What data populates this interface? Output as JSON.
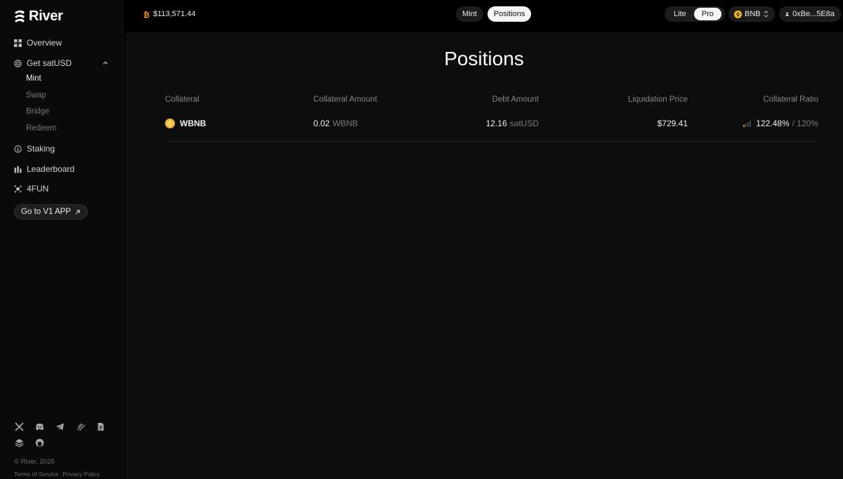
{
  "brand": {
    "name": "River"
  },
  "sidebar": {
    "items": [
      {
        "label": "Overview",
        "icon": "grid-icon"
      },
      {
        "label": "Get satUSD",
        "icon": "target-icon",
        "expanded": true,
        "subitems": [
          {
            "label": "Mint",
            "active": true
          },
          {
            "label": "Swap",
            "active": false
          },
          {
            "label": "Bridge",
            "active": false
          },
          {
            "label": "Redeem",
            "active": false
          }
        ]
      },
      {
        "label": "Staking",
        "icon": "coin-icon"
      },
      {
        "label": "Leaderboard",
        "icon": "bar-chart-icon"
      },
      {
        "label": "4FUN",
        "icon": "sparkle-icon"
      }
    ],
    "v1_button": "Go to V1 APP",
    "socials": [
      "x-icon",
      "discord-icon",
      "telegram-icon",
      "mirror-icon",
      "docs-icon",
      "layers-icon",
      "github-icon"
    ],
    "copyright": "© River, 2025",
    "terms": "Terms of Service",
    "privacy": "Privacy Policy"
  },
  "topbar": {
    "btc_price": "$113,571.44",
    "tabs": [
      {
        "label": "Mint",
        "active": false
      },
      {
        "label": "Positions",
        "active": true
      }
    ],
    "modes": [
      {
        "label": "Lite",
        "active": false
      },
      {
        "label": "Pro",
        "active": true
      }
    ],
    "chain": "BNB",
    "wallet": "0xBe...5E8a"
  },
  "main": {
    "title": "Positions",
    "columns": [
      "Collateral",
      "Collateral Amount",
      "Debt Amount",
      "Liquidation Price",
      "Collateral Ratio"
    ],
    "rows": [
      {
        "collateral": "WBNB",
        "collateral_amount": "0.02",
        "collateral_unit": "WBNB",
        "debt_amount": "12.16",
        "debt_unit": "satUSD",
        "liquidation_price": "$729.41",
        "ratio": "122.48%",
        "ratio_min": "/ 120%"
      }
    ]
  },
  "colors": {
    "bnb": "#F3BA2F",
    "btc": "#F7931A",
    "bg": "#0d0d0d"
  }
}
